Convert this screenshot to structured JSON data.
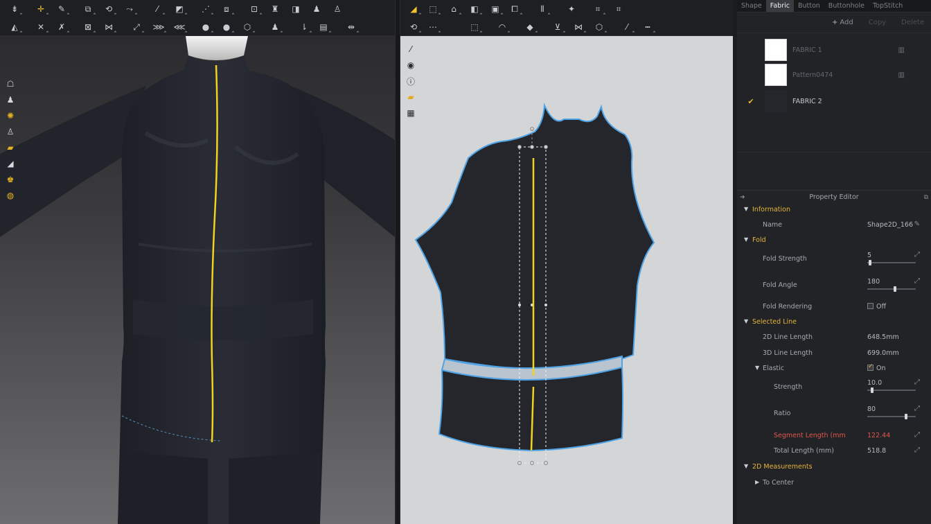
{
  "panel": {
    "tabs": [
      {
        "label": "Shape",
        "active": false
      },
      {
        "label": "Fabric",
        "active": true
      },
      {
        "label": "Button",
        "active": false
      },
      {
        "label": "Buttonhole",
        "active": false
      },
      {
        "label": "TopStitch",
        "active": false
      }
    ],
    "object_toolbar": {
      "add": "Add",
      "copy": "Copy",
      "delete": "Delete"
    },
    "fabrics": [
      {
        "name": "FABRIC 1",
        "swatch": "#ffffff",
        "selected": false
      },
      {
        "name": "Pattern0474",
        "swatch": "#ffffff",
        "selected": false
      },
      {
        "name": "FABRIC 2",
        "swatch": "#25262b",
        "selected": true
      }
    ],
    "property_editor": {
      "title": "Property Editor",
      "information": {
        "header": "Information",
        "name_label": "Name",
        "name_value": "Shape2D_166"
      },
      "fold": {
        "header": "Fold",
        "strength_label": "Fold Strength",
        "strength_value": "5",
        "strength_pct": 0.06,
        "angle_label": "Fold Angle",
        "angle_value": "180",
        "angle_pct": 0.57,
        "rendering_label": "Fold Rendering",
        "rendering_value": "Off"
      },
      "selected_line": {
        "header": "Selected Line",
        "len2d_label": "2D Line Length",
        "len2d_value": "648.5mm",
        "len3d_label": "3D Line Length",
        "len3d_value": "699.0mm",
        "elastic_label": "Elastic",
        "elastic_value": "On",
        "strength_label": "Strength",
        "strength_value": "10.0",
        "strength_pct": 0.1,
        "ratio_label": "Ratio",
        "ratio_value": "80",
        "ratio_pct": 0.8,
        "segment_label": "Segment Length (mm",
        "segment_value": "122.44",
        "total_label": "Total Length (mm)",
        "total_value": "518.8"
      },
      "measurements": {
        "header": "2D Measurements",
        "to_center_label": "To Center"
      }
    }
  },
  "colors": {
    "accent_yellow": "#e6b43b",
    "seam_yellow": "#f0d41e",
    "outline_blue": "#4ea3e6",
    "fabric_dark": "#25262b",
    "alert_red": "#e2574c"
  },
  "icons": {
    "toolbar_3d_row1": [
      "select-mesh-icon",
      "transform-icon",
      "edit-pin-icon",
      "fold-arrange-icon",
      "arrange-icon",
      "tack-icon",
      "brush-icon",
      "shirt-icon",
      "layer-icon",
      "sim-icon",
      "avatar-arrange-icon",
      "measure-icon",
      "snapshot-icon",
      "fit-icon"
    ],
    "toolbar_3d_row2": [
      "pin-icon",
      "remove-pin-icon",
      "strap-icon",
      "remove-strap-icon",
      "puckering-icon",
      "gather-icon",
      "tacking-icon",
      "button-icon",
      "buttonhole-icon",
      "zipper-icon",
      "fold-icon",
      "topstitch-icon",
      "texture-icon"
    ],
    "toolbar_2d_row1": [
      "edit-pattern-icon",
      "transform-pattern-icon",
      "add-point-icon",
      "polygon-icon",
      "rectangle-icon",
      "ellipse-icon",
      "internal-line-icon",
      "trace-icon",
      "grid-icon",
      "grid-alt-icon"
    ],
    "toolbar_2d_row2": [
      "segment-sewing-icon",
      "free-sewing-icon",
      "fold-sewing-icon",
      "check-sewing-icon",
      "elastic-icon",
      "dart-icon",
      "flip-icon",
      "rotate-icon",
      "pleat-icon",
      "ruler-icon",
      "dash-line-icon"
    ],
    "side_3d": [
      "hanger-icon",
      "garment-icon",
      "gear-sun-icon",
      "avatar-icon",
      "texture-swatch-icon",
      "shoe-icon",
      "avatar-gold-icon",
      "globe-icon"
    ],
    "side_2d": [
      "wand-icon",
      "eye-icon",
      "info-icon",
      "swatch-icon",
      "grid-small-icon"
    ]
  }
}
